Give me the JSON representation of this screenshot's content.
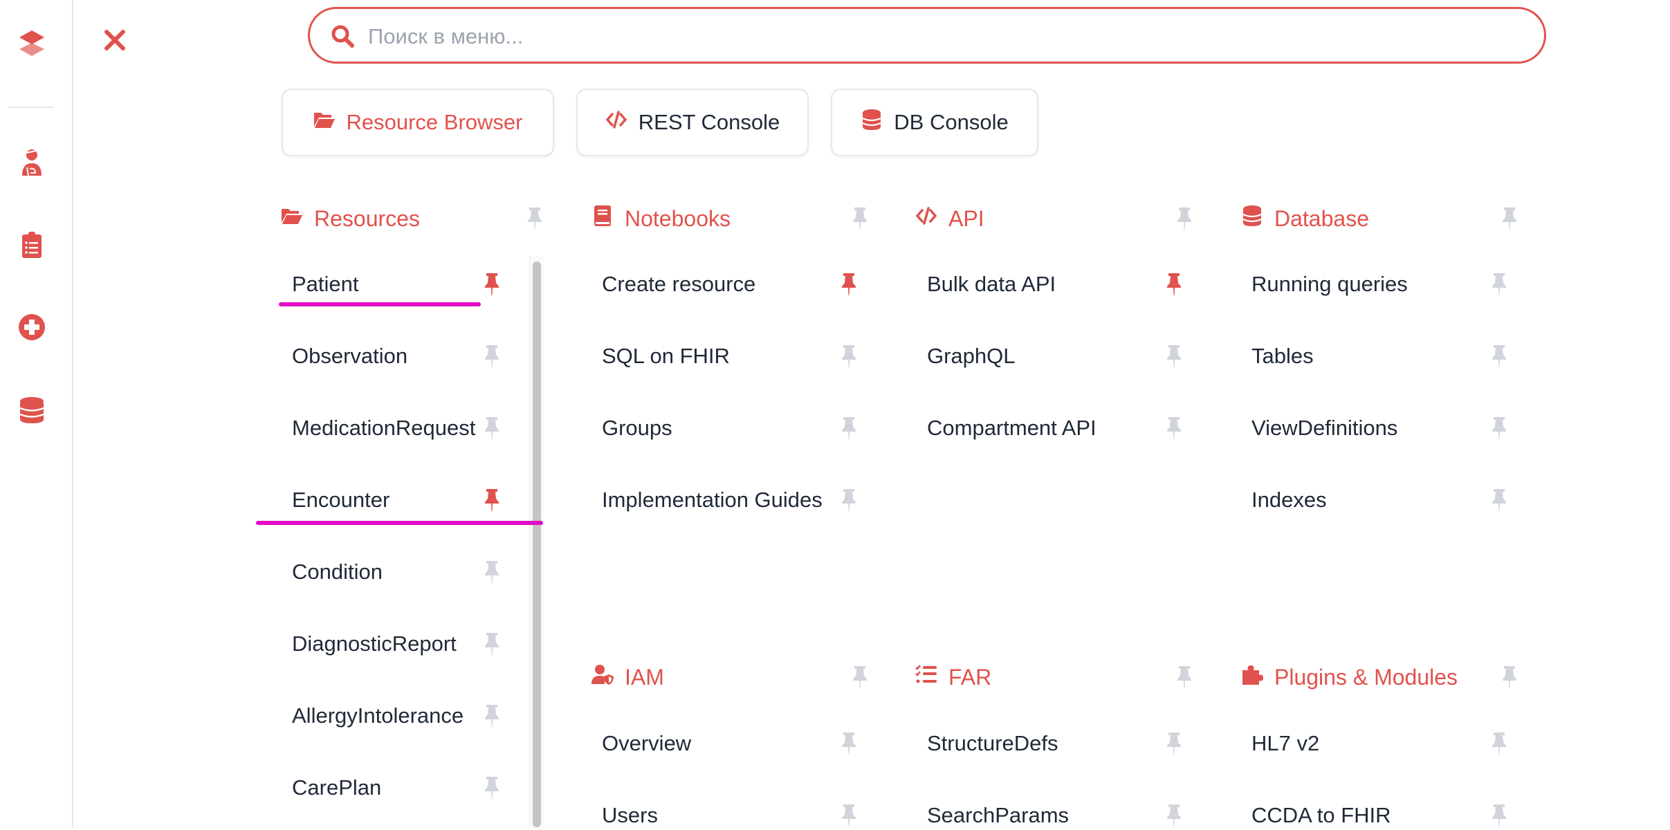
{
  "colors": {
    "accent": "#e0524d",
    "pin_inactive": "#d1d5db",
    "text": "#1f2937",
    "highlight": "#e10bc6"
  },
  "sidebar": {
    "icons": [
      "logo-icon",
      "user-injured-icon",
      "clipboard-list-icon",
      "plus-circle-icon",
      "database-icon"
    ]
  },
  "search": {
    "placeholder": "Поиск в меню...",
    "value": ""
  },
  "quick_buttons": [
    {
      "label": "Resource Browser",
      "icon": "folder-open-icon",
      "active": true
    },
    {
      "label": "REST Console",
      "icon": "code-icon",
      "active": false
    },
    {
      "label": "DB Console",
      "icon": "database-icon",
      "active": false
    }
  ],
  "sections": [
    {
      "title": "Resources",
      "icon": "folder-open",
      "items": [
        {
          "label": "Patient",
          "pinned": true
        },
        {
          "label": "Observation",
          "pinned": false
        },
        {
          "label": "MedicationRequest",
          "pinned": false
        },
        {
          "label": "Encounter",
          "pinned": true
        },
        {
          "label": "Condition",
          "pinned": false
        },
        {
          "label": "DiagnosticReport",
          "pinned": false
        },
        {
          "label": "AllergyIntolerance",
          "pinned": false
        },
        {
          "label": "CarePlan",
          "pinned": false
        }
      ]
    },
    {
      "title": "Notebooks",
      "icon": "book",
      "items": [
        {
          "label": "Create resource",
          "pinned": true
        },
        {
          "label": "SQL on FHIR",
          "pinned": false
        },
        {
          "label": "Groups",
          "pinned": false
        },
        {
          "label": "Implementation Guides",
          "pinned": false
        }
      ]
    },
    {
      "title": "API",
      "icon": "code",
      "items": [
        {
          "label": "Bulk data API",
          "pinned": true
        },
        {
          "label": "GraphQL",
          "pinned": false
        },
        {
          "label": "Compartment API",
          "pinned": false
        }
      ]
    },
    {
      "title": "Database",
      "icon": "database",
      "items": [
        {
          "label": "Running queries",
          "pinned": false
        },
        {
          "label": "Tables",
          "pinned": false
        },
        {
          "label": "ViewDefinitions",
          "pinned": false
        },
        {
          "label": "Indexes",
          "pinned": false
        }
      ]
    },
    {
      "title": "IAM",
      "icon": "user-shield",
      "items": [
        {
          "label": "Overview",
          "pinned": false
        },
        {
          "label": "Users",
          "pinned": false
        }
      ]
    },
    {
      "title": "FAR",
      "icon": "list-check",
      "items": [
        {
          "label": "StructureDefs",
          "pinned": false
        },
        {
          "label": "SearchParams",
          "pinned": false
        }
      ]
    },
    {
      "title": "Plugins & Modules",
      "icon": "puzzle",
      "items": [
        {
          "label": "HL7 v2",
          "pinned": false
        },
        {
          "label": "CCDA to FHIR",
          "pinned": false
        }
      ]
    }
  ]
}
